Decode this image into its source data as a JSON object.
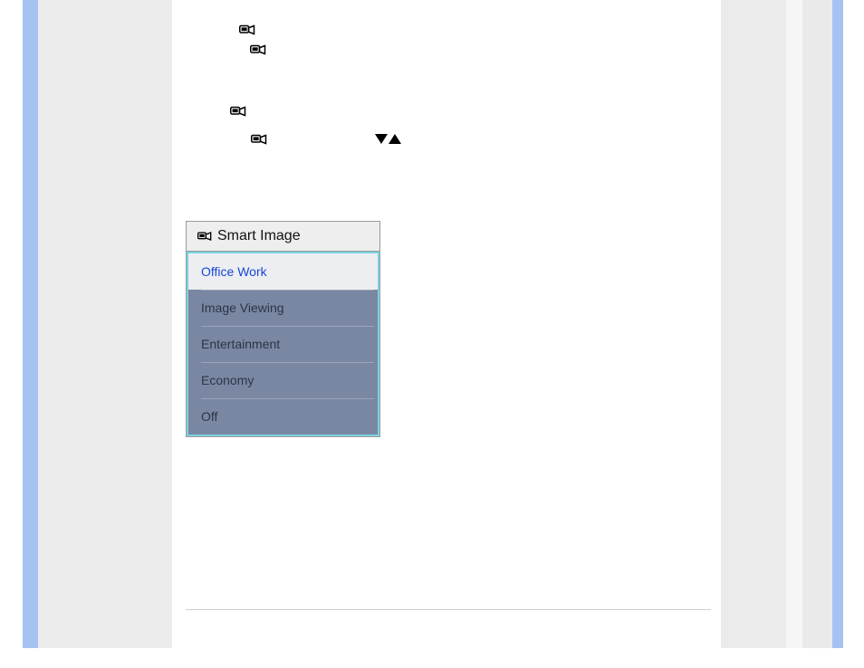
{
  "menu": {
    "title": "Smart Image",
    "items": [
      {
        "label": "Office Work",
        "selected": true
      },
      {
        "label": "Image Viewing",
        "selected": false
      },
      {
        "label": "Entertainment",
        "selected": false
      },
      {
        "label": "Economy",
        "selected": false
      },
      {
        "label": "Off",
        "selected": false
      }
    ]
  },
  "icons": {
    "i1": "smart-image-icon",
    "i2": "smart-image-icon",
    "i3": "smart-image-icon",
    "i4": "smart-image-icon",
    "header": "smart-image-icon"
  }
}
